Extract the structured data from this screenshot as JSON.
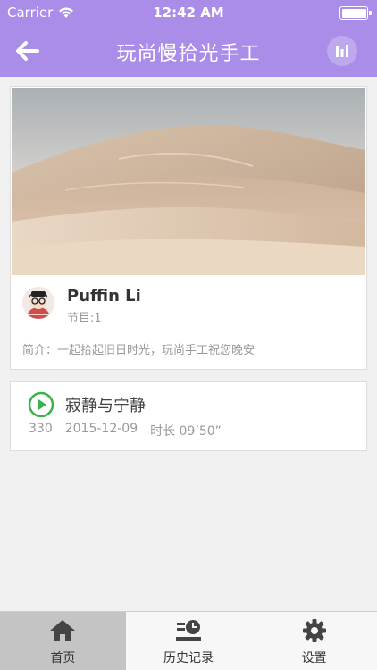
{
  "status_bar": {
    "carrier": "Carrier",
    "time": "12:42 AM"
  },
  "nav": {
    "title": "玩尚慢拾光手工"
  },
  "album": {
    "author": "Puffin Li",
    "episodes": "节目:1",
    "intro": "简介：一起拾起旧日时光，玩尚手工祝您晚安"
  },
  "episode_item": {
    "title": "寂静与宁静",
    "plays": "330",
    "date": "2015-12-09",
    "duration": "时长 09’50”"
  },
  "tabs": [
    {
      "label": "首页",
      "icon": "home-icon",
      "active": true
    },
    {
      "label": "历史记录",
      "icon": "history-icon",
      "active": false
    },
    {
      "label": "设置",
      "icon": "gear-icon",
      "active": false
    }
  ],
  "colors": {
    "accent": "#a98de8",
    "play_green": "#3cb34a"
  }
}
